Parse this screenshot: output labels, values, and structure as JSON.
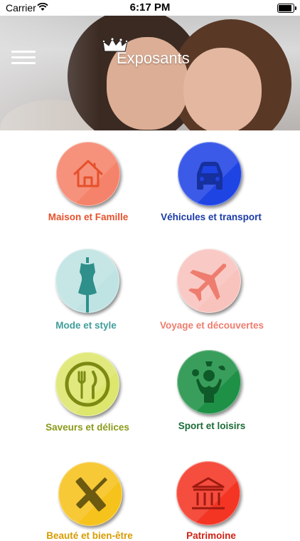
{
  "status_bar": {
    "carrier": "Carrier",
    "time": "6:17 PM"
  },
  "header": {
    "title": "Exposants",
    "menu_icon": "hamburger-menu-icon",
    "crown_icon": "crown-icon"
  },
  "categories": [
    {
      "label": "Maison et Famille",
      "icon": "house-icon",
      "color": "#f5826a",
      "label_color": "#e5512b"
    },
    {
      "label": "Véhicules et transport",
      "icon": "car-icon",
      "color": "#1f44e4",
      "label_color": "#1a3aa8"
    },
    {
      "label": "Mode et style",
      "icon": "mannequin-icon",
      "color": "#bfe3e3",
      "label_color": "#3f9d9a"
    },
    {
      "label": "Voyage et découvertes",
      "icon": "airplane-icon",
      "color": "#f9c3bd",
      "label_color": "#ee7d6f"
    },
    {
      "label": "Saveurs et délices",
      "icon": "plate-cutlery-icon",
      "color": "#dde66d",
      "label_color": "#8b9a19"
    },
    {
      "label": "Sport et loisirs",
      "icon": "sport-person-icon",
      "color": "#1e9146",
      "label_color": "#1a6b36"
    },
    {
      "label": "Beauté et bien-être",
      "icon": "beauty-cosmetics-icon",
      "color": "#f6c21c",
      "label_color": "#d79c00"
    },
    {
      "label": "Patrimoine",
      "icon": "museum-icon",
      "color": "#f43524",
      "label_color": "#cf2314"
    }
  ]
}
